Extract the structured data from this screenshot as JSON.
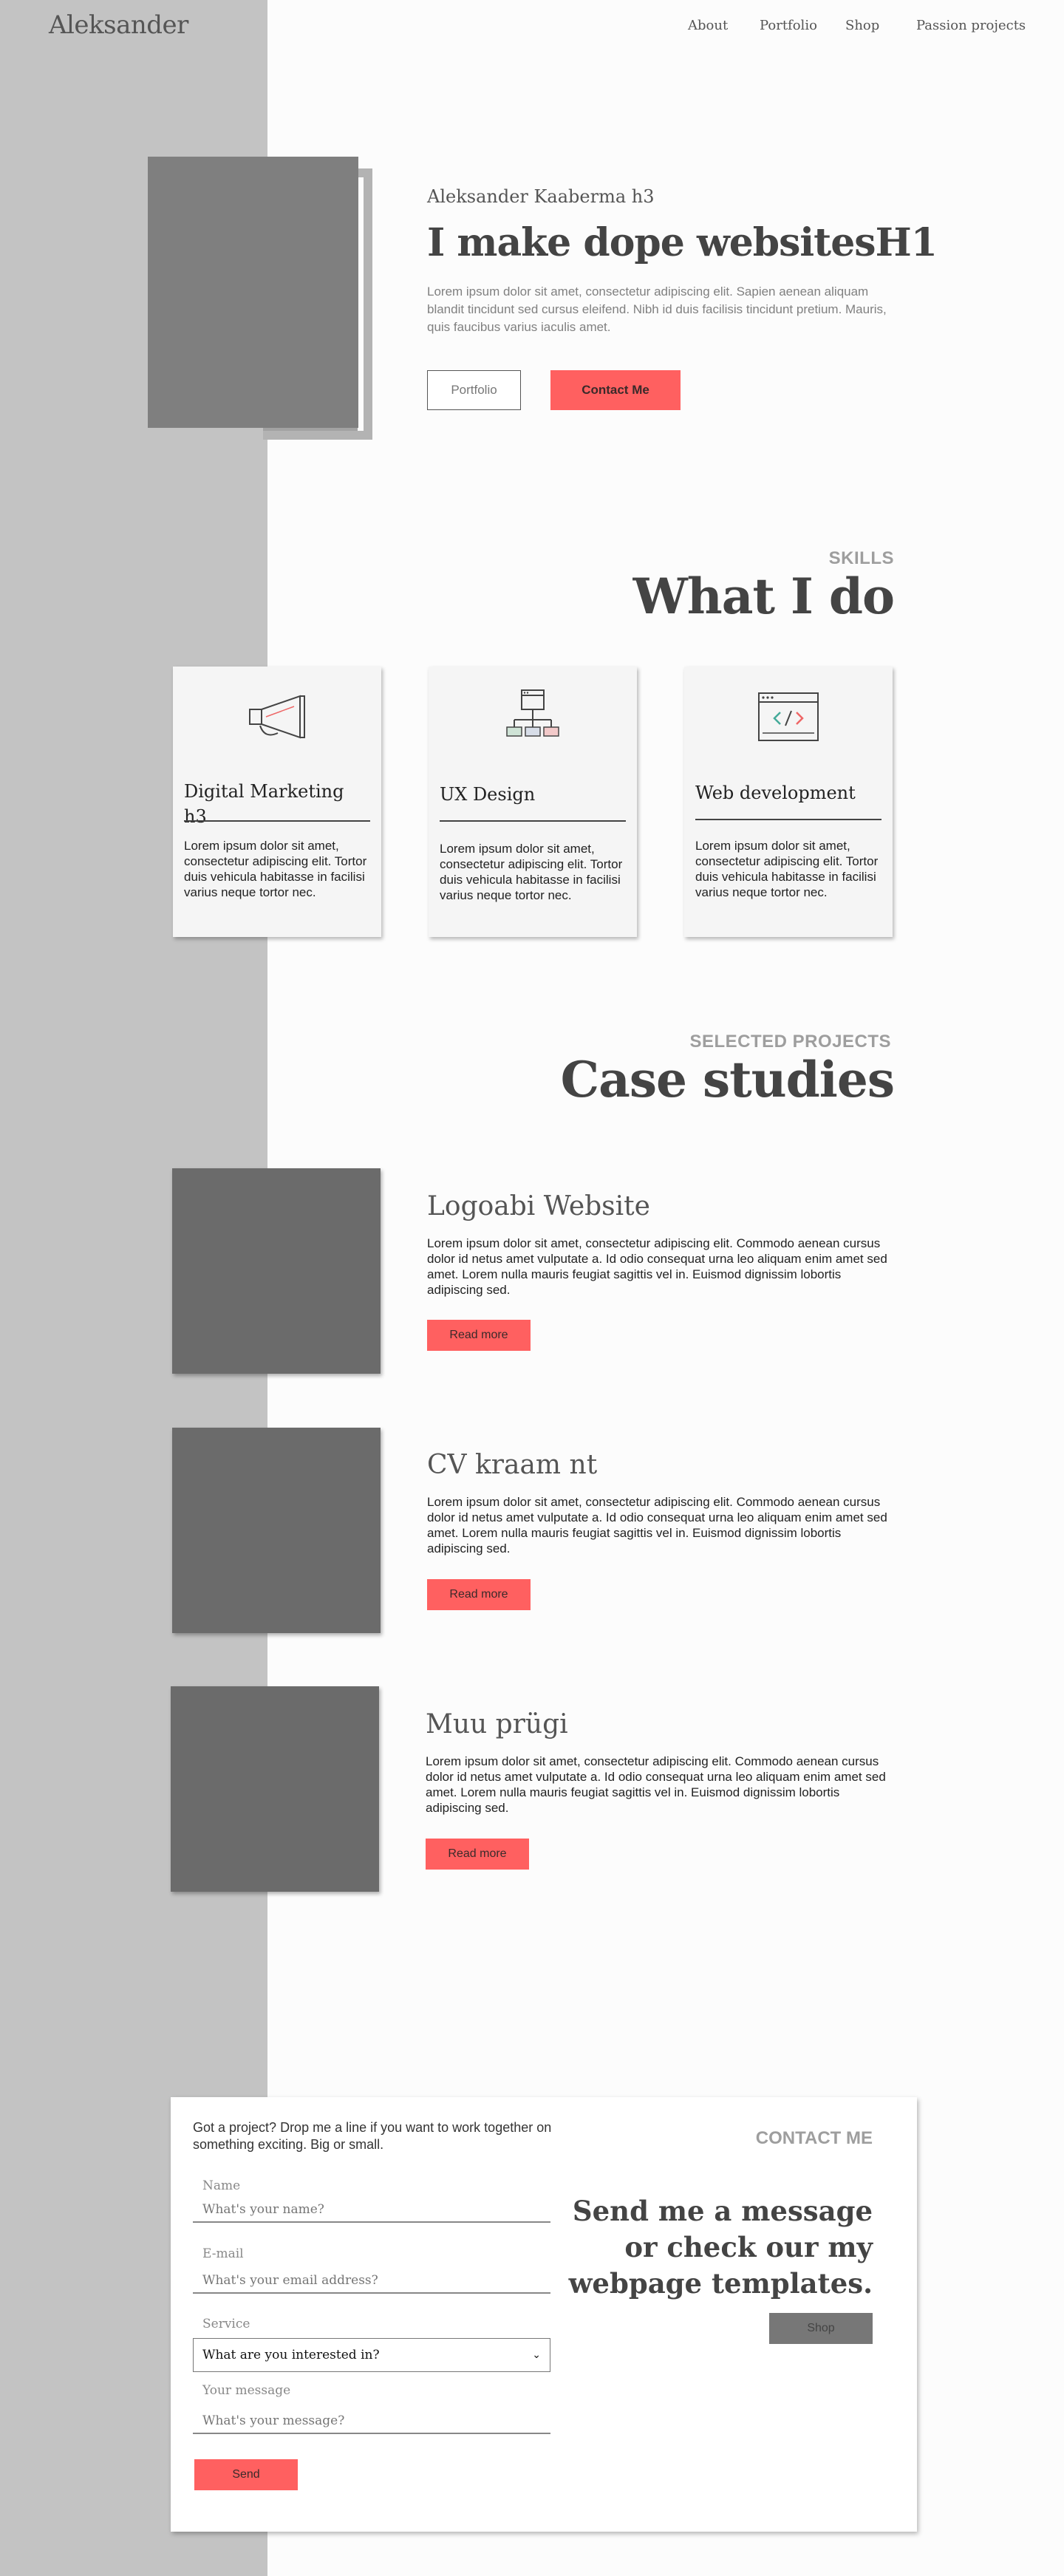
{
  "header": {
    "logo": "Aleksander",
    "nav": [
      "About",
      "Portfolio",
      "Shop",
      "Passion projects"
    ]
  },
  "hero": {
    "subtitle": "Aleksander Kaaberma h3",
    "title": "I make dope websitesH1",
    "text": "Lorem ipsum dolor sit amet, consectetur adipiscing elit. Sapien aenean aliquam blandit tincidunt sed cursus eleifend. Nibh id duis facilisis tincidunt pretium. Mauris, quis faucibus varius iaculis amet.",
    "btn_portfolio": "Portfolio",
    "btn_contact": "Contact Me"
  },
  "skills": {
    "eyebrow": "SKILLS",
    "title": "What I do",
    "cards": [
      {
        "title": "Digital Marketing h3",
        "icon": "megaphone-icon",
        "text": "Lorem ipsum dolor sit amet, consectetur adipiscing elit. Tortor duis vehicula habitasse in facilisi varius neque tortor nec."
      },
      {
        "title": "UX Design",
        "icon": "sitemap-icon",
        "text": "Lorem ipsum dolor sit amet, consectetur adipiscing elit. Tortor duis vehicula habitasse in facilisi varius neque tortor nec."
      },
      {
        "title": "Web development",
        "icon": "code-window-icon",
        "text": "Lorem ipsum dolor sit amet, consectetur adipiscing elit. Tortor duis vehicula habitasse in facilisi varius neque tortor nec."
      }
    ]
  },
  "cases": {
    "eyebrow": "SELECTED PROJECTS",
    "title": "Case studies",
    "projects": [
      {
        "title": "Logoabi Website",
        "text": "Lorem ipsum dolor sit amet, consectetur adipiscing elit. Commodo aenean cursus dolor id netus amet vulputate a. Id odio consequat urna leo aliquam enim amet sed amet. Lorem nulla mauris feugiat sagittis vel in. Euismod dignissim lobortis adipiscing sed.",
        "button": "Read more"
      },
      {
        "title": "CV kraam nt",
        "text": "Lorem ipsum dolor sit amet, consectetur adipiscing elit. Commodo aenean cursus dolor id netus amet vulputate a. Id odio consequat urna leo aliquam enim amet sed amet. Lorem nulla mauris feugiat sagittis vel in. Euismod dignissim lobortis adipiscing sed.",
        "button": "Read more"
      },
      {
        "title": "Muu prügi",
        "text": "Lorem ipsum dolor sit amet, consectetur adipiscing elit. Commodo aenean cursus dolor id netus amet vulputate a. Id odio consequat urna leo aliquam enim amet sed amet. Lorem nulla mauris feugiat sagittis vel in. Euismod dignissim lobortis adipiscing sed.",
        "button": "Read more"
      }
    ]
  },
  "contact": {
    "intro": "Got a project? Drop me a line if you want to work together on something exciting. Big or small.",
    "name_label": "Name",
    "name_placeholder": "What's your name?",
    "email_label": "E-mail",
    "email_placeholder": "What's your email address?",
    "service_label": "Service",
    "service_value": "What are you interested in?",
    "message_label": "Your message",
    "message_placeholder": "What's your message?",
    "send": "Send",
    "eyebrow": "CONTACT ME",
    "headline": "Send me a message or check our my webpage templates.",
    "shop": "Shop"
  },
  "colors": {
    "accent": "#ff6060",
    "side_band": "#c3c3c3",
    "image_placeholder": "#6b6b6b"
  }
}
